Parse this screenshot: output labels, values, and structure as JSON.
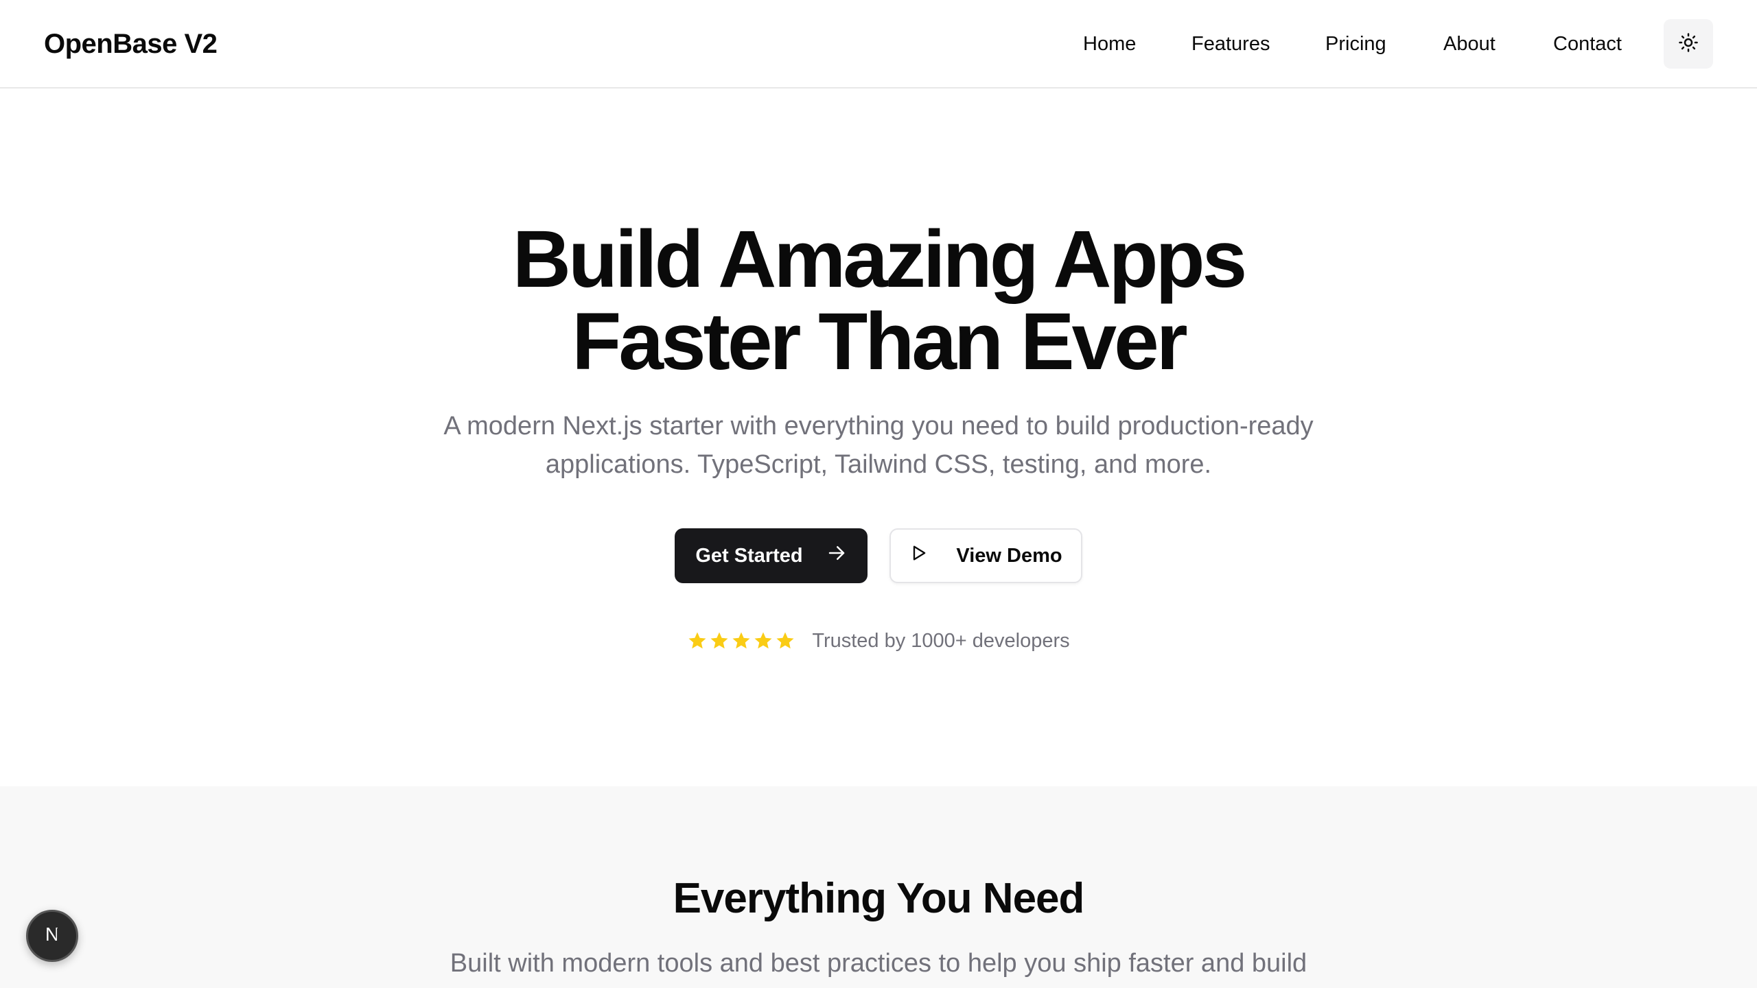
{
  "header": {
    "brand": "OpenBase V2",
    "nav": [
      {
        "label": "Home"
      },
      {
        "label": "Features"
      },
      {
        "label": "Pricing"
      },
      {
        "label": "About"
      },
      {
        "label": "Contact"
      }
    ],
    "theme_toggle_icon": "sun-icon"
  },
  "hero": {
    "title_line1": "Build Amazing Apps",
    "title_line2": "Faster Than Ever",
    "subtitle_line1": "A modern Next.js starter with everything you need to build production-ready",
    "subtitle_line2": "applications. TypeScript, Tailwind CSS, testing, and more.",
    "primary_button": "Get Started",
    "primary_button_icon": "arrow-right-icon",
    "secondary_button": "View Demo",
    "secondary_button_icon": "play-icon",
    "rating_stars": 5,
    "star_color": "#facc15",
    "trust_text": "Trusted by 1000+ developers"
  },
  "features": {
    "title": "Everything You Need",
    "subtitle": "Built with modern tools and best practices to help you ship faster and build"
  },
  "badge": {
    "letter": "N",
    "icon": "nextjs-icon"
  },
  "colors": {
    "primary": "#18181b",
    "muted_text": "#71717a",
    "section_bg": "#f8f8f8"
  }
}
